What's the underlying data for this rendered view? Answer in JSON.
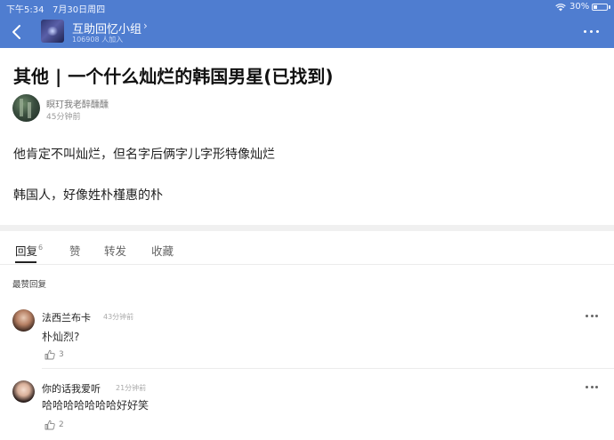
{
  "status_bar": {
    "time": "下午5:34",
    "date": "7月30日周四",
    "battery": "30%",
    "battery_level": 0.3
  },
  "group": {
    "name": "互助回忆小组",
    "chevron": "›",
    "members": "106908 人加入"
  },
  "post": {
    "title": "其他 | 一个什么灿烂的韩国男星(已找到)",
    "author": "瞑玎我老醉醺醺",
    "time": "45分钟前",
    "body": [
      "他肯定不叫灿烂，但名字后俩字儿字形特像灿烂",
      "韩国人，好像姓朴槿惠的朴"
    ]
  },
  "tabs": [
    {
      "label": "回复",
      "count": "6"
    },
    {
      "label": "赞"
    },
    {
      "label": "转发"
    },
    {
      "label": "收藏"
    }
  ],
  "section_label": "最赞回复",
  "comments": [
    {
      "name": "法西兰布卡",
      "time": "43分钟前",
      "text": "朴灿烈?",
      "likes": "3"
    },
    {
      "name": "你的话我爱听",
      "time": "21分钟前",
      "text": "哈哈哈哈哈哈哈好好笑",
      "likes": "2"
    }
  ],
  "icons": {
    "back": "back-arrow-icon",
    "more": "more-dots-icon",
    "like": "thumbs-up-icon",
    "wifi": "wifi-icon",
    "battery": "battery-icon"
  },
  "colors": {
    "header": "#4f7dd0",
    "text": "#222222"
  }
}
